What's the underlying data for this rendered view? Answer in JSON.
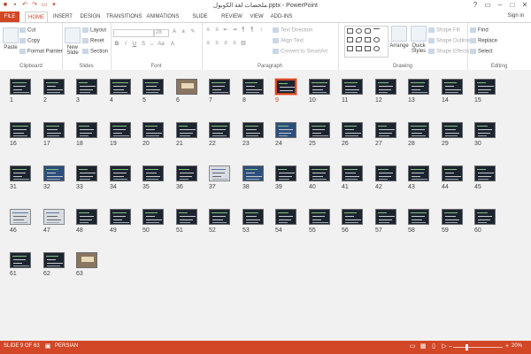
{
  "window": {
    "title": "ملخصات لغة الكوبول.pptx - PowerPoint",
    "buttons": [
      "?",
      "▭",
      "–",
      "□",
      "✕"
    ],
    "sign_in": "Sign in"
  },
  "ribbon_tabs": [
    "FILE",
    "HOME",
    "INSERT",
    "DESIGN",
    "TRANSITIONS",
    "ANIMATIONS",
    "SLIDE SHOW",
    "REVIEW",
    "VIEW",
    "ADD-INS"
  ],
  "ribbon": {
    "clipboard": {
      "label": "Clipboard",
      "paste": "Paste",
      "cut": "Cut",
      "copy": "Copy",
      "format_painter": "Format Painter"
    },
    "slides": {
      "label": "Slides",
      "new_slide": "New Slide",
      "layout": "Layout",
      "reset": "Reset",
      "section": "Section"
    },
    "font": {
      "label": "Font",
      "size_value": "28"
    },
    "paragraph": {
      "label": "Paragraph",
      "text_direction": "Text Direction",
      "align_text": "Align Text",
      "convert_smartart": "Convert to SmartArt"
    },
    "drawing": {
      "label": "Drawing",
      "arrange": "Arrange",
      "quick_styles": "Quick Styles",
      "shape_fill": "Shape Fill",
      "shape_outline": "Shape Outline",
      "shape_effects": "Shape Effects"
    },
    "editing": {
      "label": "Editing",
      "find": "Find",
      "replace": "Replace",
      "select": "Select"
    }
  },
  "sorter": {
    "slide_count": 63,
    "selected_slide": 9,
    "light_slides": [
      37,
      46,
      47
    ],
    "photo_slides": [
      6,
      63
    ],
    "blue_slides": [
      24,
      32,
      38
    ]
  },
  "status": {
    "slide_info": "SLIDE 9 OF 63",
    "language": "PERSIAN",
    "zoom": "20%"
  },
  "colors": {
    "accent": "#d24726"
  }
}
